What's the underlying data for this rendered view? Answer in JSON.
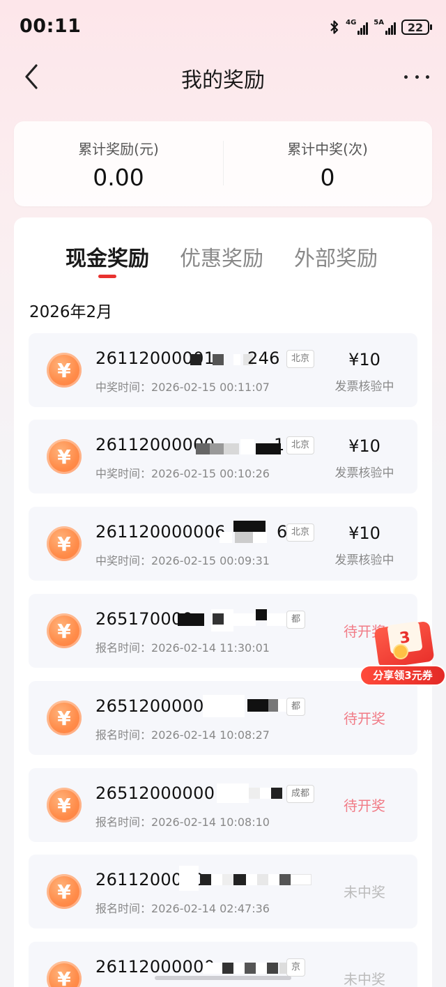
{
  "status_bar": {
    "time": "00:11",
    "network_1": "4G",
    "network_2": "5A",
    "battery": "22"
  },
  "nav": {
    "title": "我的奖励"
  },
  "summary": {
    "total_reward_label": "累计奖励(元)",
    "total_reward_value": "0.00",
    "total_wins_label": "累计中奖(次)",
    "total_wins_value": "0"
  },
  "tabs": [
    {
      "label": "现金奖励",
      "active": true
    },
    {
      "label": "优惠奖励",
      "active": false
    },
    {
      "label": "外部奖励",
      "active": false
    }
  ],
  "month": "2026年2月",
  "records": [
    {
      "number_visible": "26112000001",
      "number_tail": "246",
      "city": "北京",
      "time_label": "中奖时间：",
      "time": "2026-02-15 00:11:07",
      "amount": "¥10",
      "status": "发票核验中"
    },
    {
      "number_visible": "26112000000",
      "number_tail": "1",
      "city": "北京",
      "time_label": "中奖时间：",
      "time": "2026-02-15 00:10:26",
      "amount": "¥10",
      "status": "发票核验中"
    },
    {
      "number_visible": "261120000006",
      "number_tail": "6",
      "city": "北京",
      "time_label": "中奖时间：",
      "time": "2026-02-15 00:09:31",
      "amount": "¥10",
      "status": "发票核验中"
    },
    {
      "number_visible": "265170000",
      "number_tail": "",
      "city": "都",
      "time_label": "报名时间：",
      "time": "2026-02-14 11:30:01",
      "status": "待开奖"
    },
    {
      "number_visible": "2651200000",
      "number_tail": "",
      "city": "都",
      "time_label": "报名时间：",
      "time": "2026-02-14 10:08:27",
      "status": "待开奖"
    },
    {
      "number_visible": "26512000000",
      "number_tail": "",
      "city": "成都",
      "time_label": "报名时间：",
      "time": "2026-02-14 10:08:10",
      "status": "待开奖"
    },
    {
      "number_visible": "2611200000",
      "number_tail": "",
      "city": "",
      "time_label": "报名时间：",
      "time": "2026-02-14 02:47:36",
      "status": "未中奖"
    },
    {
      "number_visible": "26112000000",
      "number_tail": "",
      "city": "京",
      "time_label": "",
      "time": "",
      "status": "未中奖"
    }
  ],
  "share_widget": {
    "badge": "3",
    "label": "分享领3元券"
  },
  "icons": {
    "coin": "yuan-coin-icon",
    "back": "chevron-left-icon",
    "more": "more-horizontal-icon"
  },
  "colors": {
    "accent": "#e8322f",
    "pending": "#f17b86",
    "coin": "#ff8c4a"
  }
}
